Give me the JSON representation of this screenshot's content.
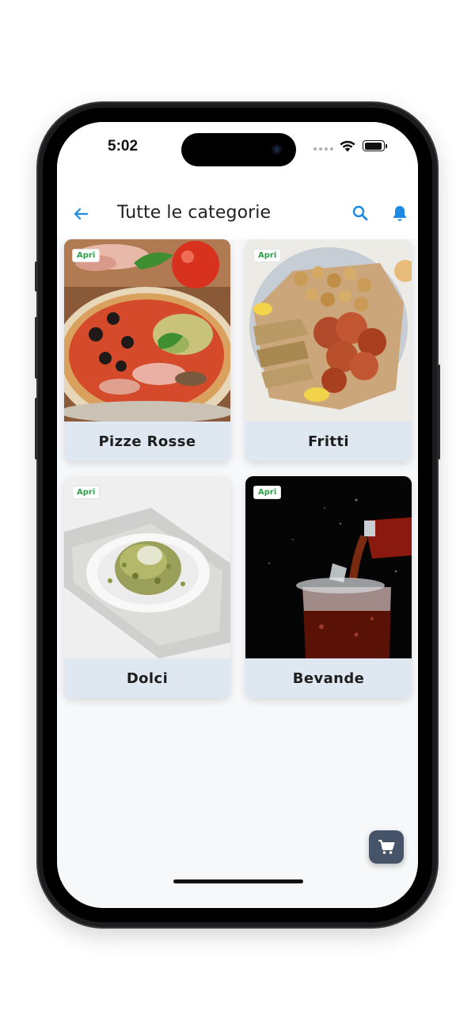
{
  "status_bar": {
    "time": "5:02"
  },
  "app_bar": {
    "title": "Tutte le categorie",
    "back_icon": "arrow-left-icon",
    "search_icon": "search-icon",
    "notifications_icon": "bell-icon",
    "accent_color": "#1e88e5"
  },
  "categories": [
    {
      "label": "Pizze Rosse",
      "badge": "Apri",
      "image": "pizza-photo"
    },
    {
      "label": "Fritti",
      "badge": "Apri",
      "image": "fried-seafood-photo"
    },
    {
      "label": "Dolci",
      "badge": "Apri",
      "image": "dessert-photo"
    },
    {
      "label": "Bevande",
      "badge": "Apri",
      "image": "cola-drink-photo"
    }
  ],
  "badge_color": "#2e9e48",
  "card_label_background": "#dfe7f1",
  "cart_button": {
    "icon": "cart-icon",
    "background": "#46546a"
  }
}
